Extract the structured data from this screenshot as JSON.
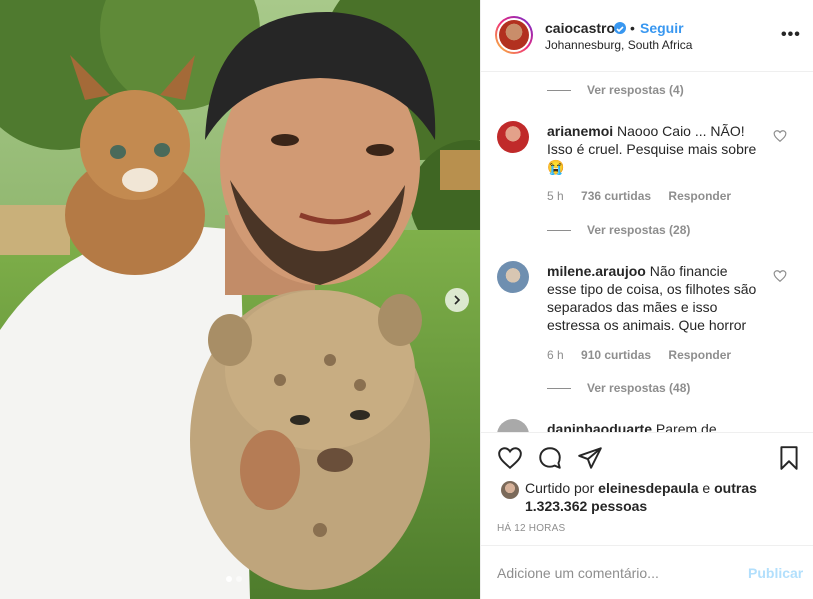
{
  "post": {
    "username": "caiocastro",
    "separator": "•",
    "follow_label": "Seguir",
    "location": "Johannesburg, South Africa",
    "more_label": "•••"
  },
  "comments": {
    "replies_1": "Ver respostas (4)",
    "c1": {
      "user": "arianemoi",
      "text": " Naooo Caio ... NÃO! Isso é cruel. Pesquise mais sobre 😭",
      "time": "5 h",
      "likes": "736 curtidas",
      "reply": "Responder"
    },
    "replies_2": "Ver respostas (28)",
    "c2": {
      "user": "milene.araujoo",
      "text": " Não financie esse tipo de coisa, os filhotes são separados das mães e isso estressa os animais. Que horror",
      "time": "6 h",
      "likes": "910 curtidas",
      "reply": "Responder"
    },
    "replies_3": "Ver respostas (48)",
    "c3": {
      "user": "daninhaoduarte",
      "text": " Parem de"
    }
  },
  "likes": {
    "prefix": "Curtido por ",
    "user": "eleinesdepaula",
    "mid": " e ",
    "others": "outras 1.323.362 pessoas"
  },
  "timestamp": "HÁ 12 HORAS",
  "composer": {
    "placeholder": "Adicione um comentário...",
    "publish": "Publicar"
  },
  "colors": {
    "accent": "#3897f0",
    "muted": "#8e8e8e",
    "publish_disabled": "#b2dffc"
  },
  "icons": [
    "heart-icon",
    "comment-icon",
    "share-icon",
    "bookmark-icon",
    "verified-icon",
    "chevron-right-icon",
    "more-icon"
  ]
}
